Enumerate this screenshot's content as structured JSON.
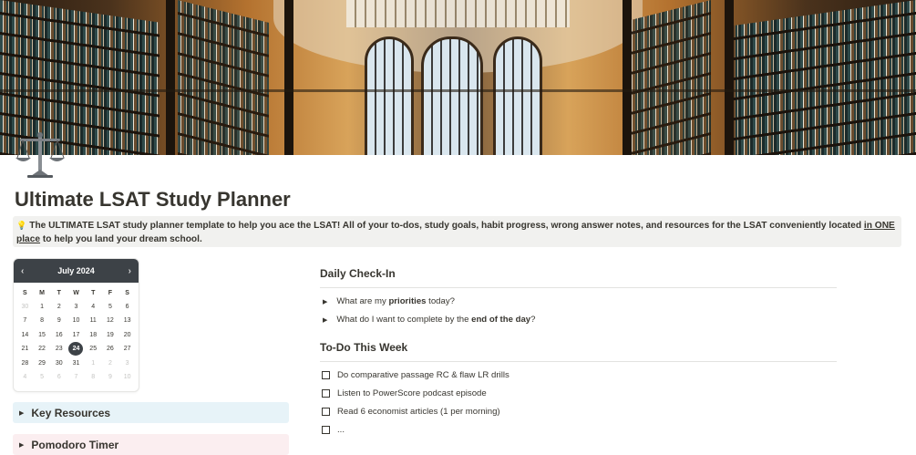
{
  "cover": {
    "description_icon": "library-cover-image"
  },
  "page": {
    "icon": "scales-icon",
    "title": "Ultimate LSAT Study Planner",
    "callout": {
      "icon": "lightbulb-icon",
      "text_before": "The ULTIMATE LSAT study planner template to help you ace the LSAT! All of your to-dos, study goals, habit progress, wrong answer notes, and resources for the LSAT conveniently located ",
      "link": "in ONE place",
      "text_after": " to help you land your dream school."
    }
  },
  "calendar": {
    "month_label": "July 2024",
    "prev": "‹",
    "next": "›",
    "weekdays": [
      "S",
      "M",
      "T",
      "W",
      "T",
      "F",
      "S"
    ],
    "days": [
      {
        "n": "30",
        "m": true
      },
      {
        "n": "1"
      },
      {
        "n": "2"
      },
      {
        "n": "3"
      },
      {
        "n": "4"
      },
      {
        "n": "5"
      },
      {
        "n": "6"
      },
      {
        "n": "7"
      },
      {
        "n": "8"
      },
      {
        "n": "9"
      },
      {
        "n": "10"
      },
      {
        "n": "11"
      },
      {
        "n": "12"
      },
      {
        "n": "13"
      },
      {
        "n": "14"
      },
      {
        "n": "15"
      },
      {
        "n": "16"
      },
      {
        "n": "17"
      },
      {
        "n": "18"
      },
      {
        "n": "19"
      },
      {
        "n": "20"
      },
      {
        "n": "21"
      },
      {
        "n": "22"
      },
      {
        "n": "23"
      },
      {
        "n": "24",
        "t": true
      },
      {
        "n": "25"
      },
      {
        "n": "26"
      },
      {
        "n": "27"
      },
      {
        "n": "28"
      },
      {
        "n": "29"
      },
      {
        "n": "30"
      },
      {
        "n": "31"
      },
      {
        "n": "1",
        "m": true
      },
      {
        "n": "2",
        "m": true
      },
      {
        "n": "3",
        "m": true
      },
      {
        "n": "4",
        "m": true
      },
      {
        "n": "5",
        "m": true
      },
      {
        "n": "6",
        "m": true
      },
      {
        "n": "7",
        "m": true
      },
      {
        "n": "8",
        "m": true
      },
      {
        "n": "9",
        "m": true
      },
      {
        "n": "10",
        "m": true
      }
    ]
  },
  "left_toggles": {
    "key_resources": "Key Resources",
    "pomodoro": "Pomodoro Timer"
  },
  "daily_checkin": {
    "heading": "Daily Check-In",
    "items": [
      {
        "before": "What are my ",
        "bold": "priorities",
        "after": " today?"
      },
      {
        "before": "What do I want to complete by the ",
        "bold": "end of the day",
        "after": "?"
      }
    ]
  },
  "todo_week": {
    "heading": "To-Do This Week",
    "items": [
      "Do comparative passage RC & flaw LR drills",
      "Listen to PowerScore podcast episode",
      "Read 6 economist articles (1 per morning)",
      "..."
    ]
  }
}
